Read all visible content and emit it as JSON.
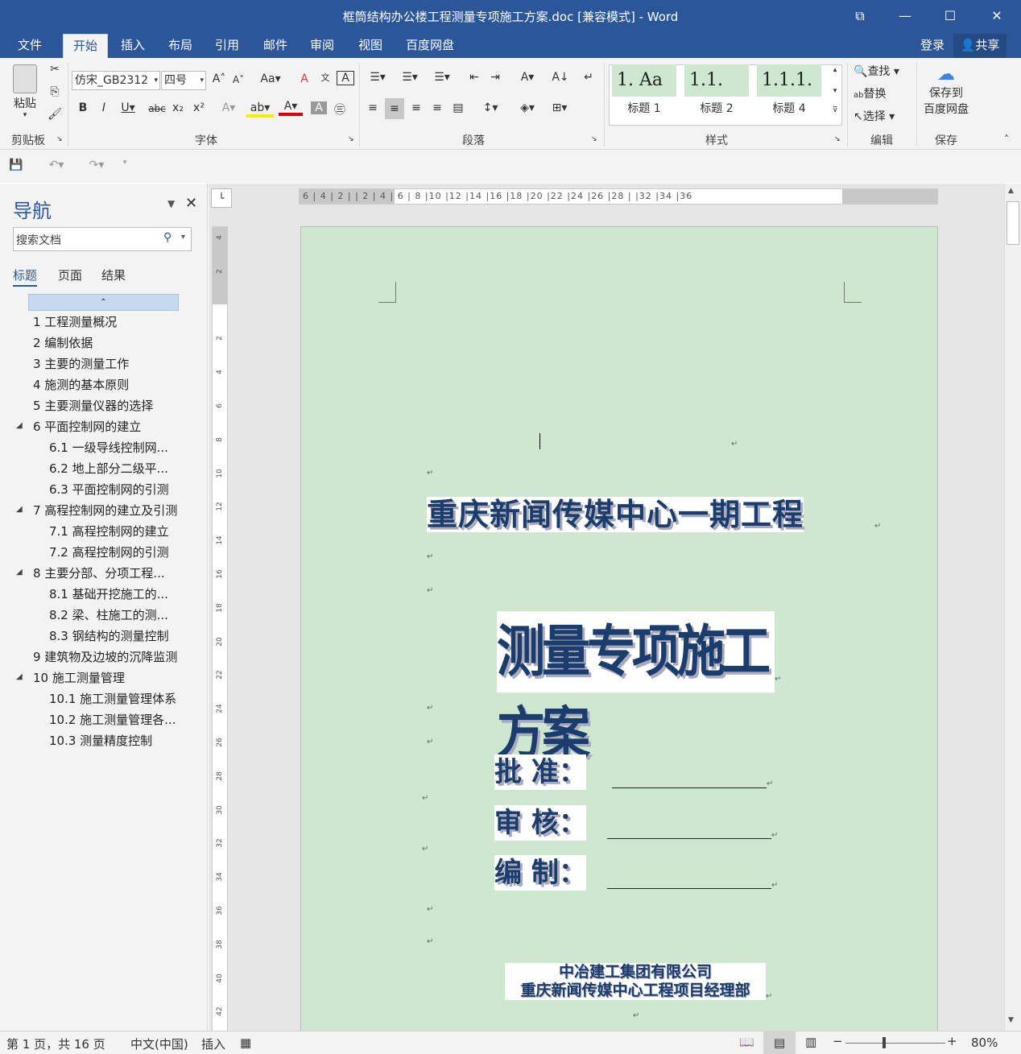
{
  "titlebar": {
    "title": "框筒结构办公楼工程测量专项施工方案.doc [兼容模式] - Word"
  },
  "menu": {
    "tabs": [
      "文件",
      "开始",
      "插入",
      "布局",
      "引用",
      "邮件",
      "审阅",
      "视图",
      "百度网盘"
    ],
    "active": "开始",
    "login": "登录",
    "share": "共享"
  },
  "ribbon": {
    "clipboard": {
      "paste": "粘贴",
      "label": "剪贴板"
    },
    "font": {
      "name": "仿宋_GB2312",
      "size": "四号",
      "label": "字体",
      "clear_format_icon": "Aa"
    },
    "paragraph": {
      "label": "段落"
    },
    "styles": {
      "label": "样式",
      "items": [
        {
          "sample": "1.  Aa",
          "name": "标题 1"
        },
        {
          "sample": "1.1.",
          "name": "标题 2"
        },
        {
          "sample": "1.1.1.",
          "name": "标题 4"
        }
      ]
    },
    "editing": {
      "find": "查找",
      "replace": "替换",
      "select": "选择",
      "label": "编辑"
    },
    "save": {
      "line1": "保存到",
      "line2": "百度网盘",
      "label": "保存"
    }
  },
  "nav": {
    "title": "导航",
    "search_placeholder": "搜索文档",
    "tabs": [
      "标题",
      "页面",
      "结果"
    ],
    "active_tab": "标题",
    "items": [
      {
        "text": "1  工程测量概况",
        "level": 1,
        "expandable": false
      },
      {
        "text": "2  编制依据",
        "level": 1,
        "expandable": false
      },
      {
        "text": "3  主要的测量工作",
        "level": 1,
        "expandable": false
      },
      {
        "text": "4  施测的基本原则",
        "level": 1,
        "expandable": false
      },
      {
        "text": "5  主要测量仪器的选择",
        "level": 1,
        "expandable": false
      },
      {
        "text": "6  平面控制网的建立",
        "level": 1,
        "expandable": true
      },
      {
        "text": "6.1  一级导线控制网...",
        "level": 2,
        "expandable": false
      },
      {
        "text": "6.2  地上部分二级平...",
        "level": 2,
        "expandable": false
      },
      {
        "text": "6.3 平面控制网的引测",
        "level": 2,
        "expandable": false
      },
      {
        "text": "7 高程控制网的建立及引测",
        "level": 1,
        "expandable": true
      },
      {
        "text": "7.1 高程控制网的建立",
        "level": 2,
        "expandable": false
      },
      {
        "text": "7.2 高程控制网的引测",
        "level": 2,
        "expandable": false
      },
      {
        "text": "8  主要分部、分项工程...",
        "level": 1,
        "expandable": true
      },
      {
        "text": "8.1  基础开挖施工的...",
        "level": 2,
        "expandable": false
      },
      {
        "text": "8.2  梁、柱施工的测...",
        "level": 2,
        "expandable": false
      },
      {
        "text": "8.3  钢结构的测量控制",
        "level": 2,
        "expandable": false
      },
      {
        "text": "9 建筑物及边坡的沉降监测",
        "level": 1,
        "expandable": false
      },
      {
        "text": "10 施工测量管理",
        "level": 1,
        "expandable": true
      },
      {
        "text": "10.1  施工测量管理体系",
        "level": 2,
        "expandable": false
      },
      {
        "text": "10.2  施工测量管理各...",
        "level": 2,
        "expandable": false
      },
      {
        "text": "10.3  测量精度控制",
        "level": 2,
        "expandable": false
      }
    ]
  },
  "ruler": {
    "horizontal": "6 | 4 | 2 |   | 2 | 4 | 6 | 8 |10 |12 |14 |16 |18 |20 |22 |24 |26 |28 |   |32 |34 |36",
    "vertical": [
      "4",
      "2",
      "",
      "2",
      "4",
      "6",
      "8",
      "10",
      "12",
      "14",
      "16",
      "18",
      "20",
      "22",
      "24",
      "26",
      "28",
      "30",
      "32",
      "34",
      "36",
      "38",
      "40",
      "42"
    ]
  },
  "document": {
    "project_title": "重庆新闻传媒中心一期工程",
    "main_title": "测量专项施工方案",
    "approve": "批  准：",
    "review": "审  核：",
    "compile": "编  制：",
    "company_line1": "中冶建工集团有限公司",
    "company_line2": "重庆新闻传媒中心工程项目经理部",
    "para_mark": "↵"
  },
  "status": {
    "page": "第 1 页，共 16 页",
    "language": "中文(中国)",
    "mode": "插入",
    "zoom": "80%"
  },
  "colors": {
    "brand": "#2b579a",
    "page_bg": "#cde8cf",
    "wordart": "#1a3d6e"
  }
}
